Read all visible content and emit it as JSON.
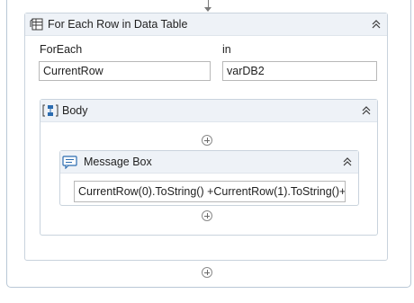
{
  "foreach_activity": {
    "title": "For Each Row in Data Table",
    "foreach_label": "ForEach",
    "foreach_value": "CurrentRow",
    "in_label": "in",
    "in_value": "varDB2"
  },
  "body_activity": {
    "title": "Body"
  },
  "message_box": {
    "title": "Message Box",
    "text_value": "CurrentRow(0).ToString() +CurrentRow(1).ToString()+"
  },
  "icons": [
    "datatable-icon",
    "sequence-icon",
    "message-icon",
    "collapse-icon",
    "add-activity-icon",
    "flow-arrow-icon"
  ],
  "colors": {
    "header_bg": "#eef2f7",
    "border": "#c9d3dd",
    "icon_blue": "#2b6cb0"
  }
}
